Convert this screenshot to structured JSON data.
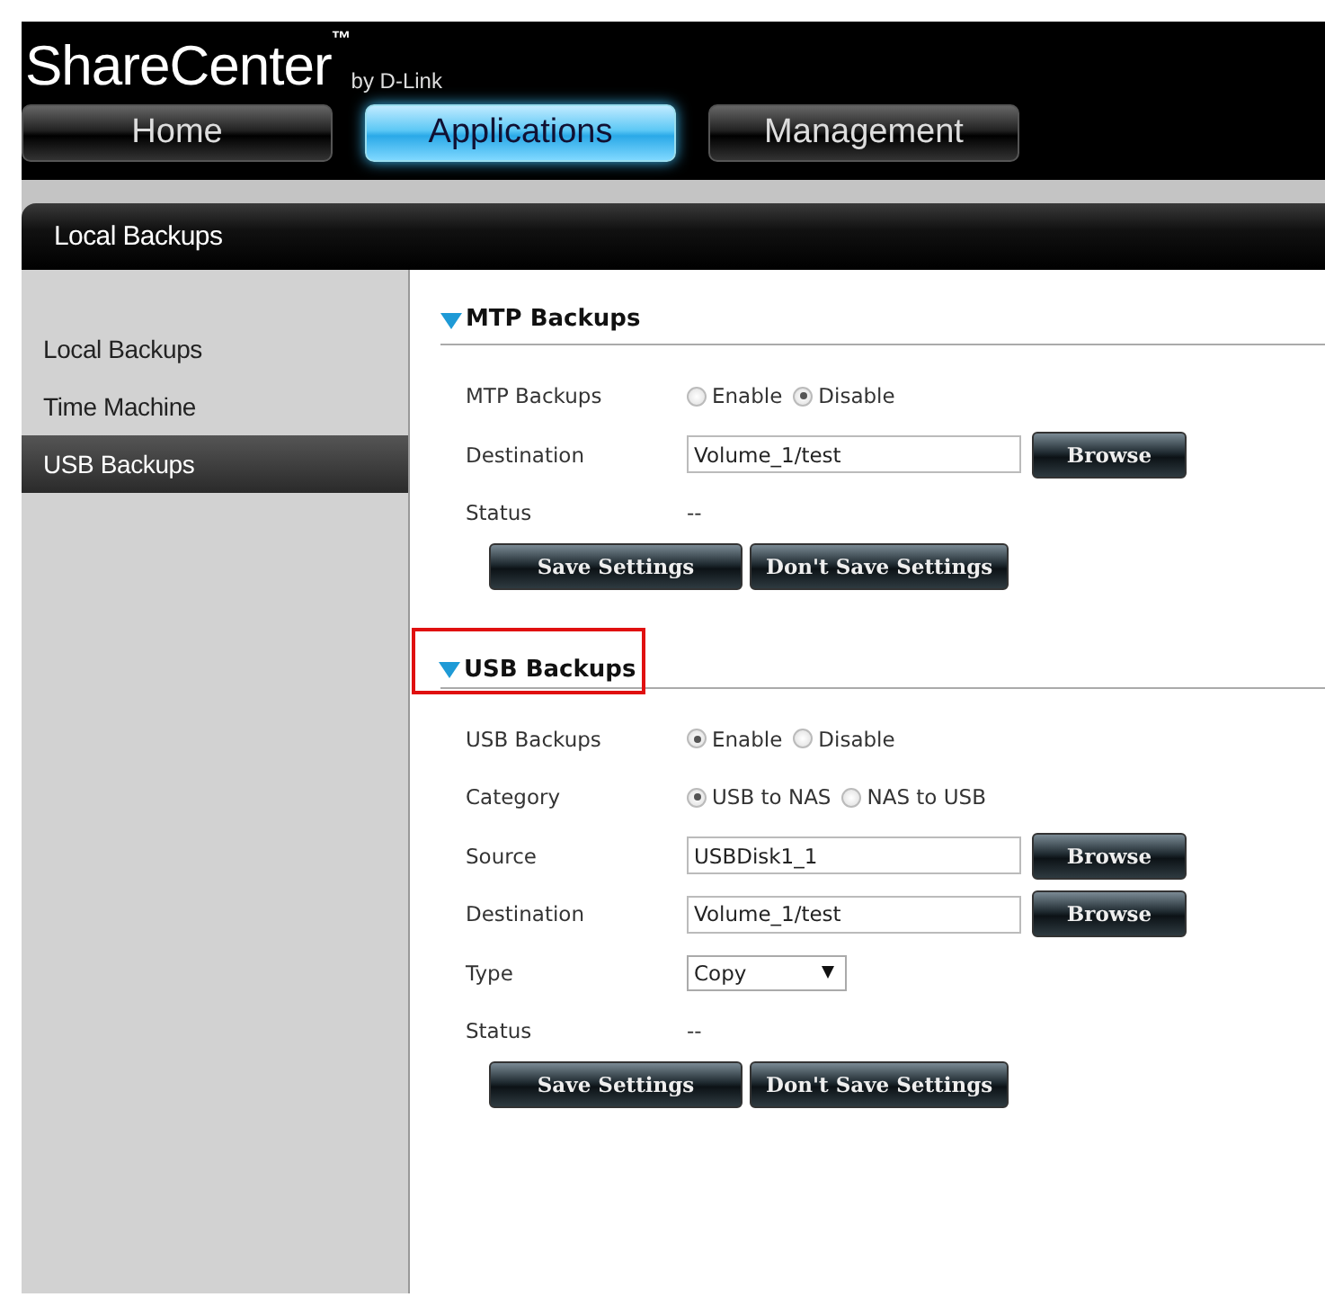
{
  "brand": {
    "name": "ShareCenter",
    "trademark": "™",
    "byline": "by D-Link"
  },
  "nav_tabs": [
    {
      "label": "Home",
      "selected": false
    },
    {
      "label": "Applications",
      "selected": true
    },
    {
      "label": "Management",
      "selected": false
    }
  ],
  "page_title": "Local Backups",
  "sidebar": {
    "items": [
      {
        "label": "Local Backups",
        "selected": false
      },
      {
        "label": "Time Machine",
        "selected": false
      },
      {
        "label": "USB Backups",
        "selected": true
      }
    ]
  },
  "sections": [
    {
      "title": "MTP Backups",
      "expanded": true,
      "highlighted": false,
      "rows": [
        {
          "kind": "radio",
          "label": "MTP Backups",
          "options": [
            {
              "label": "Enable",
              "selected": false
            },
            {
              "label": "Disable",
              "selected": true
            }
          ]
        },
        {
          "kind": "path",
          "label": "Destination",
          "value": "Volume_1/test",
          "button": "Browse"
        },
        {
          "kind": "text",
          "label": "Status",
          "value": "--"
        }
      ],
      "buttons": [
        "Save Settings",
        "Don't Save Settings"
      ]
    },
    {
      "title": "USB Backups",
      "expanded": true,
      "highlighted": true,
      "rows": [
        {
          "kind": "radio",
          "label": "USB Backups",
          "options": [
            {
              "label": "Enable",
              "selected": true
            },
            {
              "label": "Disable",
              "selected": false
            }
          ]
        },
        {
          "kind": "radio",
          "label": "Category",
          "options": [
            {
              "label": "USB to NAS",
              "selected": true
            },
            {
              "label": "NAS to USB",
              "selected": false
            }
          ]
        },
        {
          "kind": "path",
          "label": "Source",
          "value": "USBDisk1_1",
          "button": "Browse"
        },
        {
          "kind": "path",
          "label": "Destination",
          "value": "Volume_1/test",
          "button": "Browse"
        },
        {
          "kind": "select",
          "label": "Type",
          "value": "Copy"
        },
        {
          "kind": "text",
          "label": "Status",
          "value": "--"
        }
      ],
      "buttons": [
        "Save Settings",
        "Don't Save Settings"
      ]
    }
  ]
}
